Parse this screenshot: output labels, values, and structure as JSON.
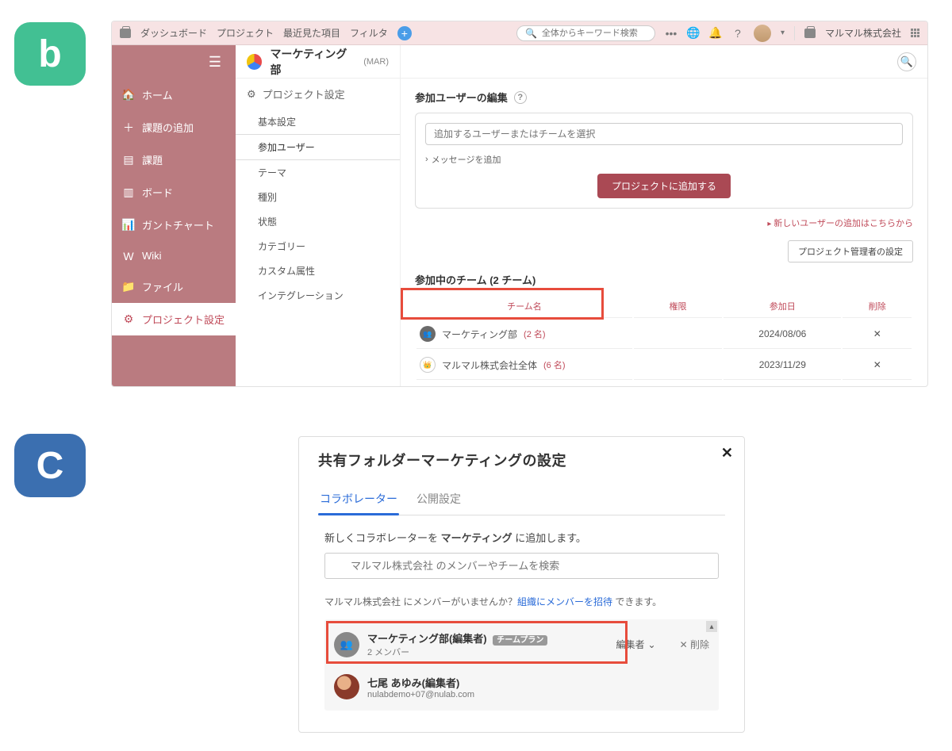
{
  "badges": {
    "b": "b",
    "c": "C"
  },
  "app1": {
    "topnav": {
      "dashboard": "ダッシュボード",
      "project": "プロジェクト",
      "recent": "最近見た項目",
      "filter": "フィルタ"
    },
    "search_placeholder": "全体からキーワード検索",
    "org_name": "マルマル株式会社",
    "left_nav": [
      "ホーム",
      "課題の追加",
      "課題",
      "ボード",
      "ガントチャート",
      "Wiki",
      "ファイル",
      "プロジェクト設定"
    ],
    "project": {
      "title": "マーケティング部",
      "code": "(MAR)"
    },
    "settings_header": "プロジェクト設定",
    "settings_items": [
      "基本設定",
      "参加ユーザー",
      "テーマ",
      "種別",
      "状態",
      "カテゴリー",
      "カスタム属性",
      "インテグレーション"
    ],
    "main": {
      "section_title": "参加ユーザーの編集",
      "add_placeholder": "追加するユーザーまたはチームを選択",
      "message_link": "メッセージを追加",
      "add_button": "プロジェクトに追加する",
      "right_link": "新しいユーザーの追加はこちらから",
      "admin_button": "プロジェクト管理者の設定",
      "teams_header": "参加中のチーム (2 チーム)",
      "table": {
        "headers": [
          "チーム名",
          "権限",
          "参加日",
          "削除"
        ],
        "rows": [
          {
            "name": "マーケティング部",
            "count": "(2 名)",
            "perm": "",
            "date": "2024/08/06"
          },
          {
            "name": "マルマル株式会社全体",
            "count": "(6 名)",
            "perm": "",
            "date": "2023/11/29"
          }
        ]
      }
    }
  },
  "app2": {
    "title": "共有フォルダーマーケティングの設定",
    "tabs": {
      "collab": "コラボレーター",
      "publish": "公開設定"
    },
    "add_prefix": "新しくコラボレーターを ",
    "add_bold": "マーケティング",
    "add_suffix": " に追加します。",
    "search_placeholder": "マルマル株式会社 のメンバーやチームを検索",
    "invite_prefix": "マルマル株式会社 にメンバーがいませんか？",
    "invite_link": "組織にメンバーを招待",
    "invite_suffix": " できます。",
    "members": [
      {
        "name": "マーケティング部",
        "role_suffix": "(編集者)",
        "plan_badge": "チームプラン",
        "sub": "2 メンバー",
        "role": "編集者",
        "delete": "削除"
      },
      {
        "name": "七尾 あゆみ",
        "role_suffix": "(編集者)",
        "sub": "nulabdemo+07@nulab.com"
      }
    ]
  }
}
